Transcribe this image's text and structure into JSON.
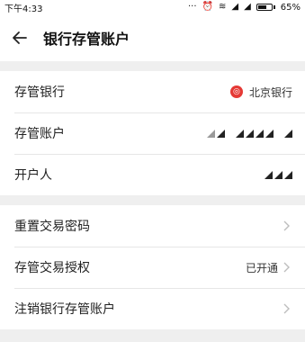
{
  "status_bar": {
    "time": "下午4:33",
    "battery": "65%"
  },
  "header": {
    "title": "银行存管账户"
  },
  "info_section": {
    "bank": {
      "label": "存管银行",
      "value": "北京银行"
    },
    "account": {
      "label": "存管账户"
    },
    "holder": {
      "label": "开户人"
    }
  },
  "actions_section": {
    "reset_password": {
      "label": "重置交易密码"
    },
    "authorization": {
      "label": "存管交易授权",
      "status": "已开通"
    },
    "cancel_account": {
      "label": "注销银行存管账户"
    }
  }
}
